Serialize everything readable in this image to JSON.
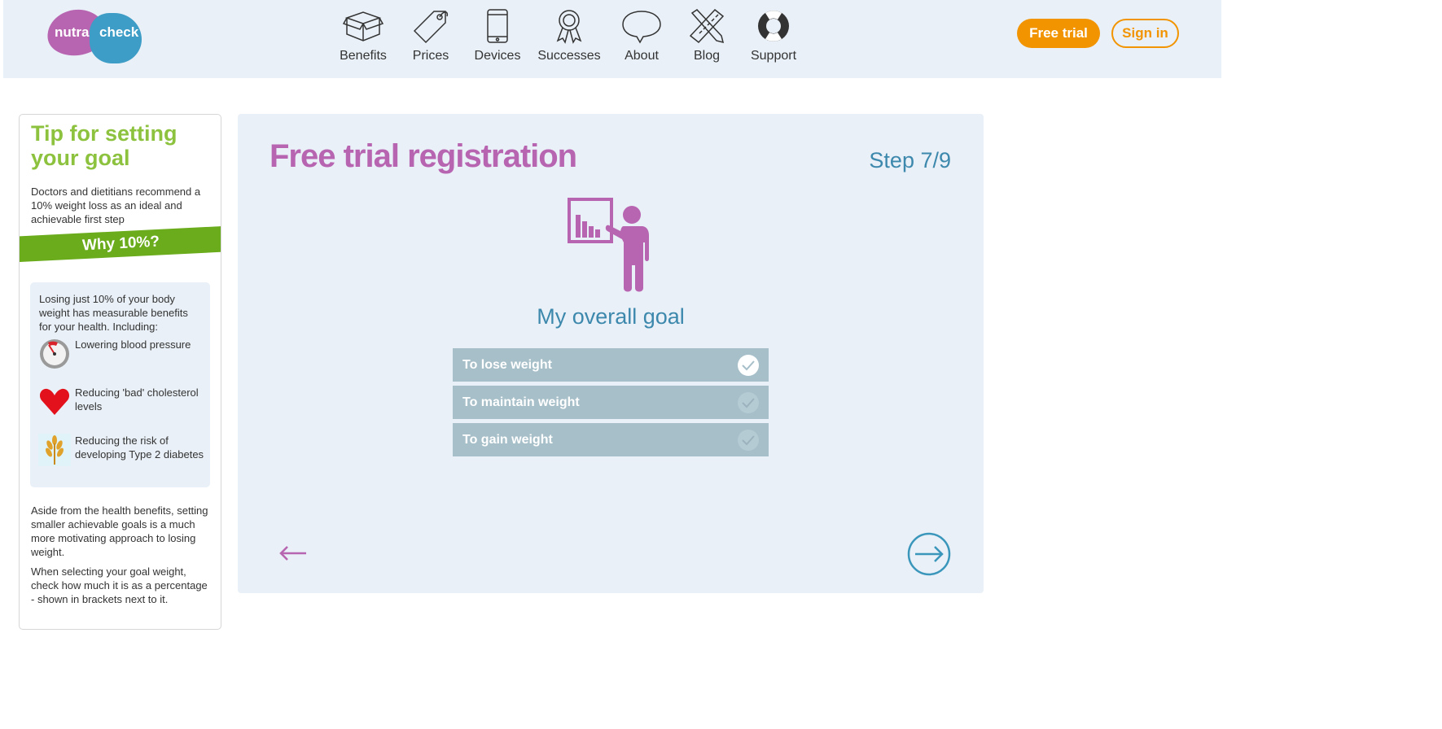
{
  "header": {
    "logo": {
      "part1": "nutra",
      "part2": "check",
      "colors": {
        "left": "#b764b1",
        "right": "#3d9dc6"
      }
    },
    "nav": [
      {
        "label": "Benefits",
        "icon": "box-icon"
      },
      {
        "label": "Prices",
        "icon": "price-tag-icon"
      },
      {
        "label": "Devices",
        "icon": "phone-icon"
      },
      {
        "label": "Successes",
        "icon": "award-ribbon-icon"
      },
      {
        "label": "About",
        "icon": "speech-bubble-icon"
      },
      {
        "label": "Blog",
        "icon": "pencil-ruler-icon"
      },
      {
        "label": "Support",
        "icon": "lifebuoy-icon"
      }
    ],
    "free_trial_label": "Free trial",
    "sign_in_label": "Sign in",
    "accent_color": "#f29400"
  },
  "tip": {
    "title": "Tip for setting your goal",
    "intro": "Doctors and dietitians recommend a 10% weight loss as an ideal and achievable first step",
    "banner": "Why 10%?",
    "box_intro": "Losing just 10% of your body weight has measurable benefits for your health. Including:",
    "benefits": [
      {
        "text": "Lowering blood pressure",
        "icon": "blood-pressure-gauge-icon"
      },
      {
        "text": "Reducing 'bad' cholesterol levels",
        "icon": "heart-icon"
      },
      {
        "text": "Reducing the risk of developing Type 2 diabetes",
        "icon": "wheat-icon"
      }
    ],
    "outro1": "Aside from the health benefits, setting smaller achievable goals is a much more motivating approach to losing weight.",
    "outro2": "When selecting your goal weight, check how much it is as a percentage - shown in brackets next to it."
  },
  "registration": {
    "title": "Free trial registration",
    "step": "Step 7/9",
    "goal_title": "My overall goal",
    "options": [
      {
        "label": "To lose weight",
        "selected": true
      },
      {
        "label": "To maintain weight",
        "selected": false
      },
      {
        "label": "To gain weight",
        "selected": false
      }
    ],
    "back_icon": "arrow-left-icon",
    "next_icon": "arrow-right-circle-icon"
  }
}
